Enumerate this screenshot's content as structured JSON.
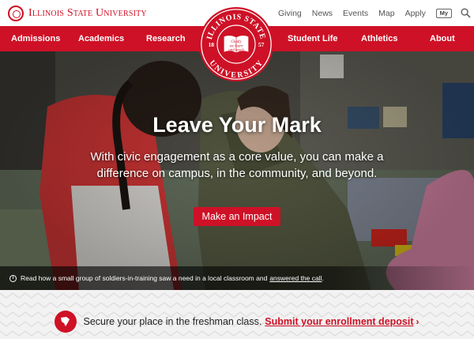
{
  "brand": {
    "name": "Illinois State University"
  },
  "utility_nav": {
    "items": [
      "Giving",
      "News",
      "Events",
      "Map",
      "Apply"
    ],
    "my_label": "My"
  },
  "main_nav": {
    "left": [
      "Admissions",
      "Academics",
      "Research"
    ],
    "right": [
      "Student Life",
      "Athletics",
      "About"
    ]
  },
  "seal": {
    "top_text": "ILLINOIS STATE",
    "bottom_text": "UNIVERSITY",
    "year_left": "18",
    "year_right": "57",
    "motto": [
      "Gladly",
      "we learn",
      "and teach"
    ]
  },
  "hero": {
    "headline": "Leave Your Mark",
    "body": "With civic engagement as a core value, you can make a difference on campus, in the community, and beyond.",
    "cta_label": "Make an Impact",
    "caption_text": "Read how a small group of soldiers-in-training saw a need in a local classroom and",
    "caption_link": "answered the call",
    "caption_end": "."
  },
  "enrollment": {
    "text": "Secure your place in the freshman class.",
    "link": "Submit your enrollment deposit",
    "arrow": "›"
  },
  "colors": {
    "brand_red": "#ce1126",
    "white": "#ffffff",
    "strip_gray": "#f2f2f2"
  }
}
